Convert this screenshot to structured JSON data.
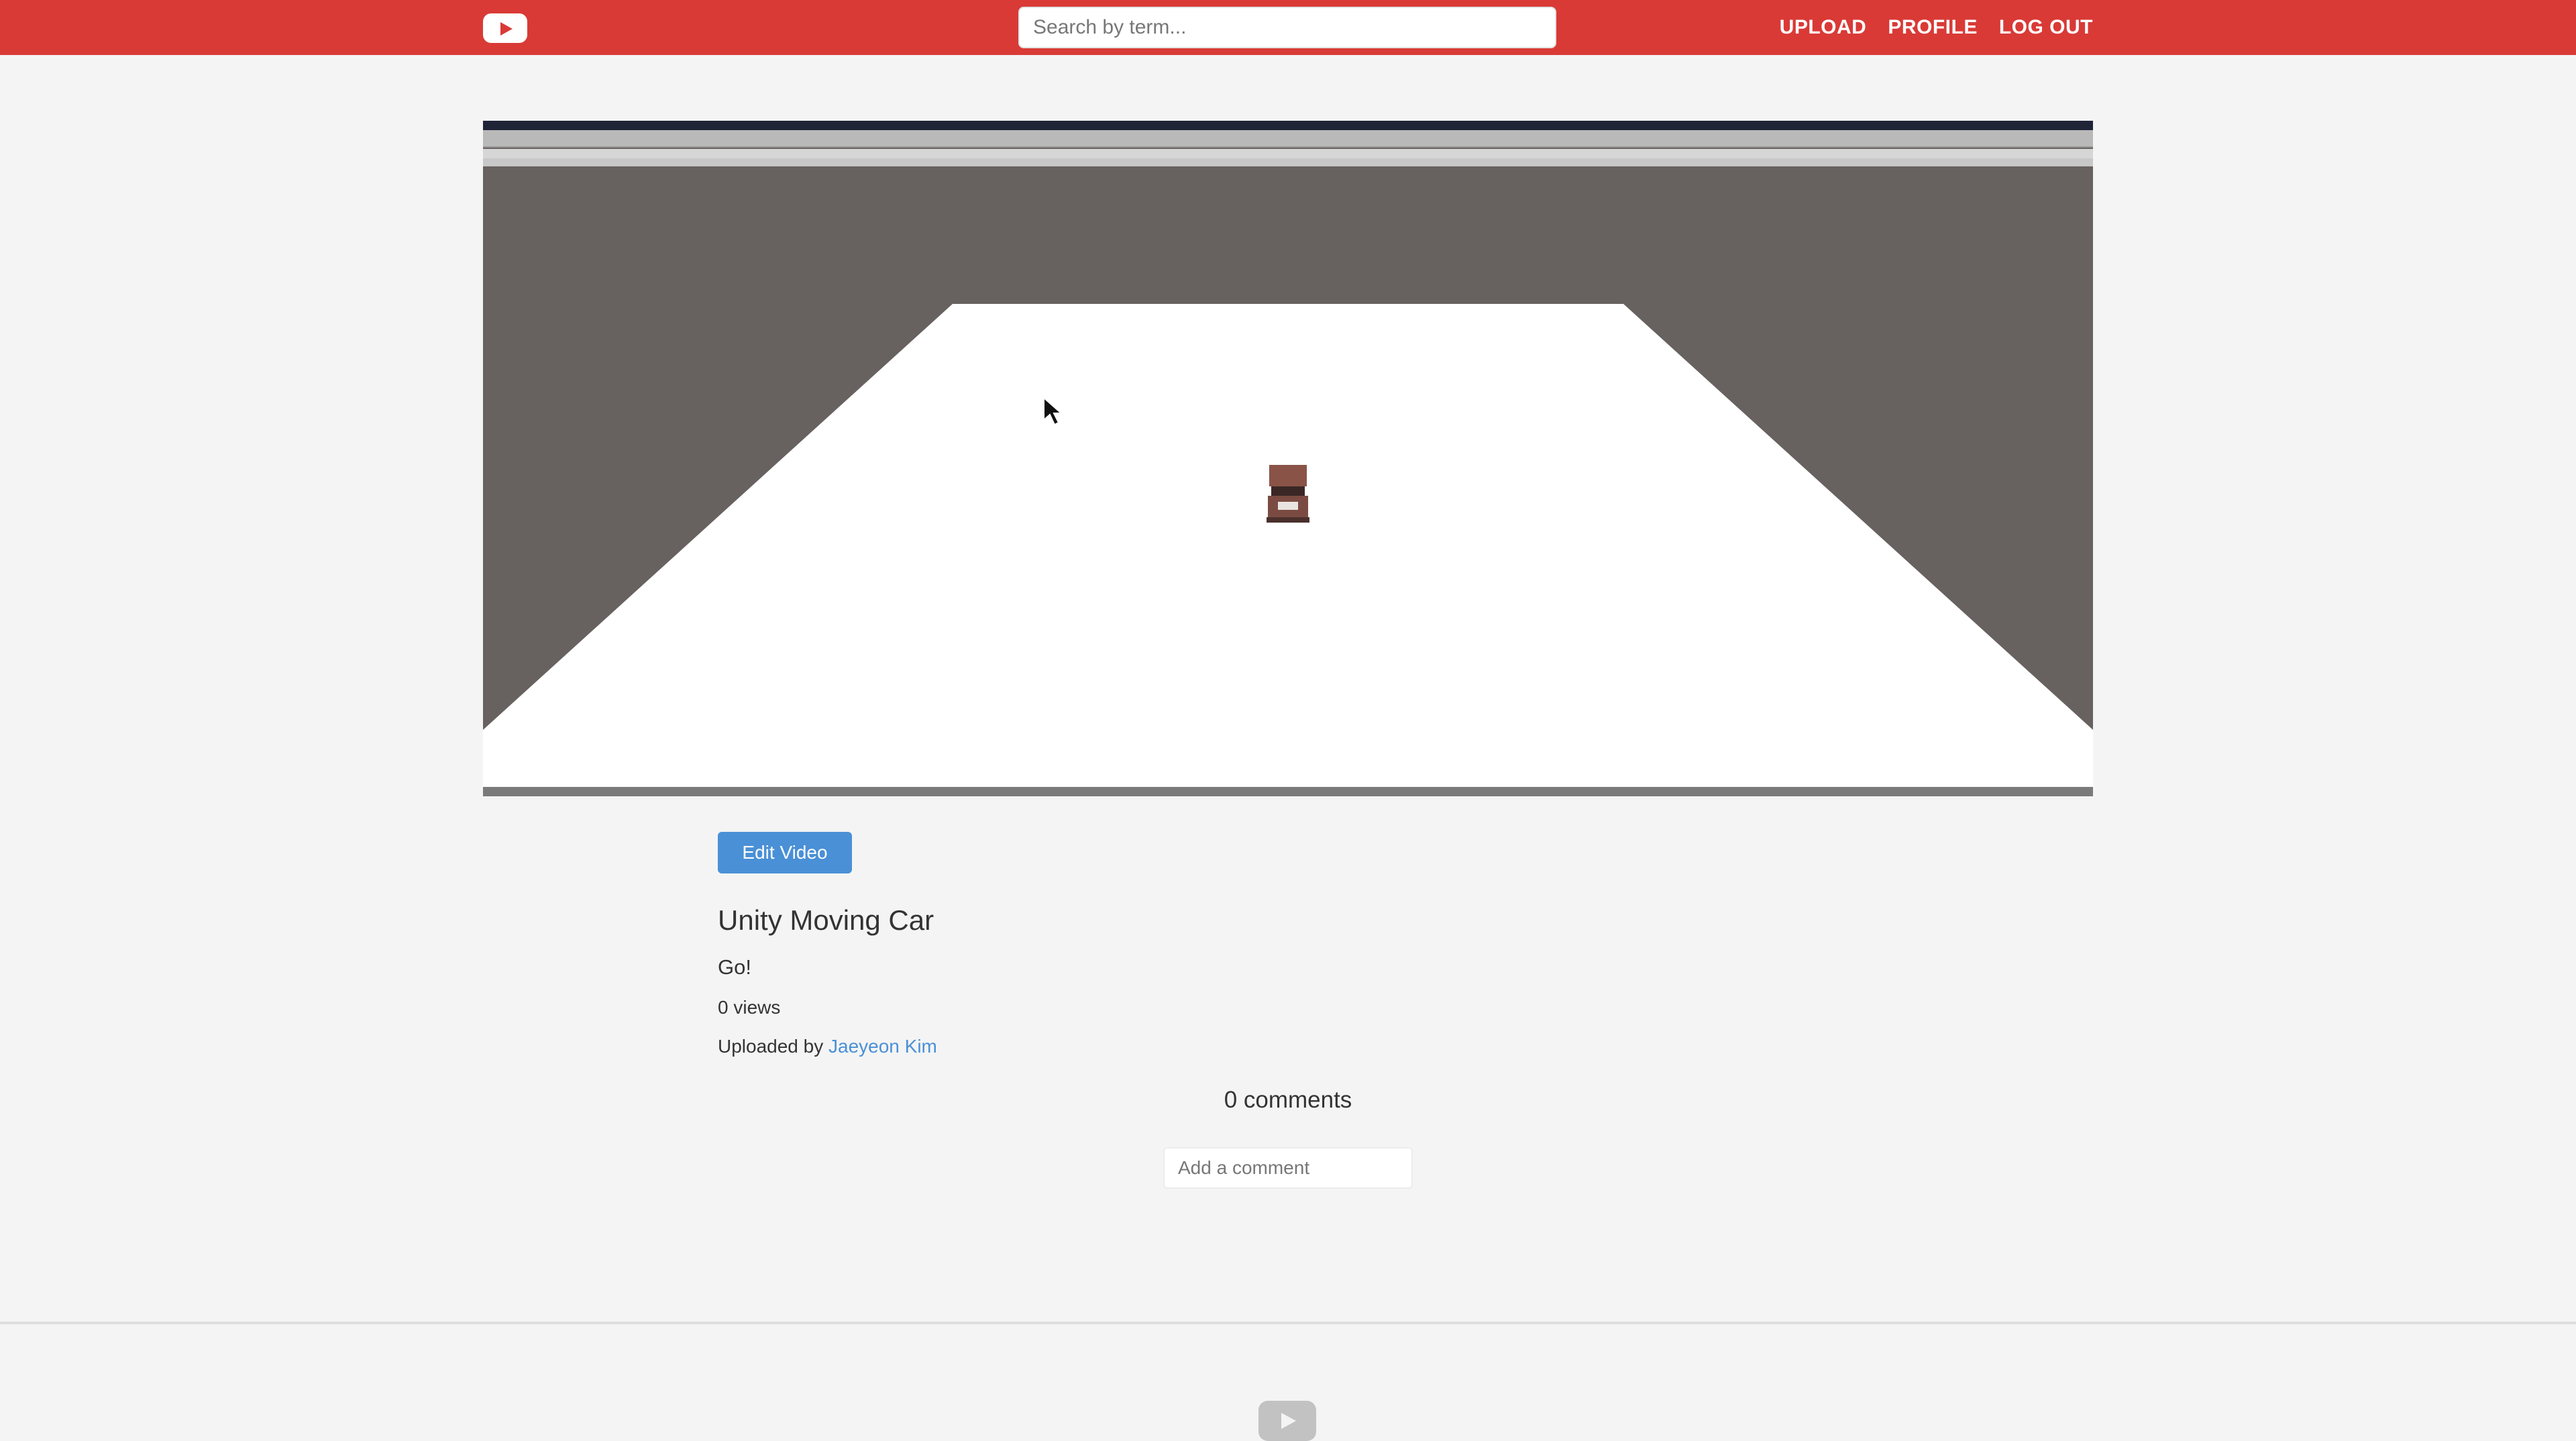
{
  "header": {
    "logo_icon": "youtube-play-icon",
    "search_placeholder": "Search by term...",
    "nav": [
      "UPLOAD",
      "PROFILE",
      "LOG OUT"
    ],
    "brand_color": "#d93a36"
  },
  "video": {
    "scene": "unity-moving-car-scene"
  },
  "actions": {
    "edit_label": "Edit Video"
  },
  "details": {
    "title": "Unity Moving Car",
    "description": "Go!",
    "views": "0 views",
    "uploaded_prefix": "Uploaded by ",
    "uploader_name": "Jaeyeon Kim"
  },
  "comments": {
    "count_label": "0 comments",
    "input_placeholder": "Add a comment"
  },
  "footer": {
    "logo_icon": "youtube-play-icon"
  }
}
